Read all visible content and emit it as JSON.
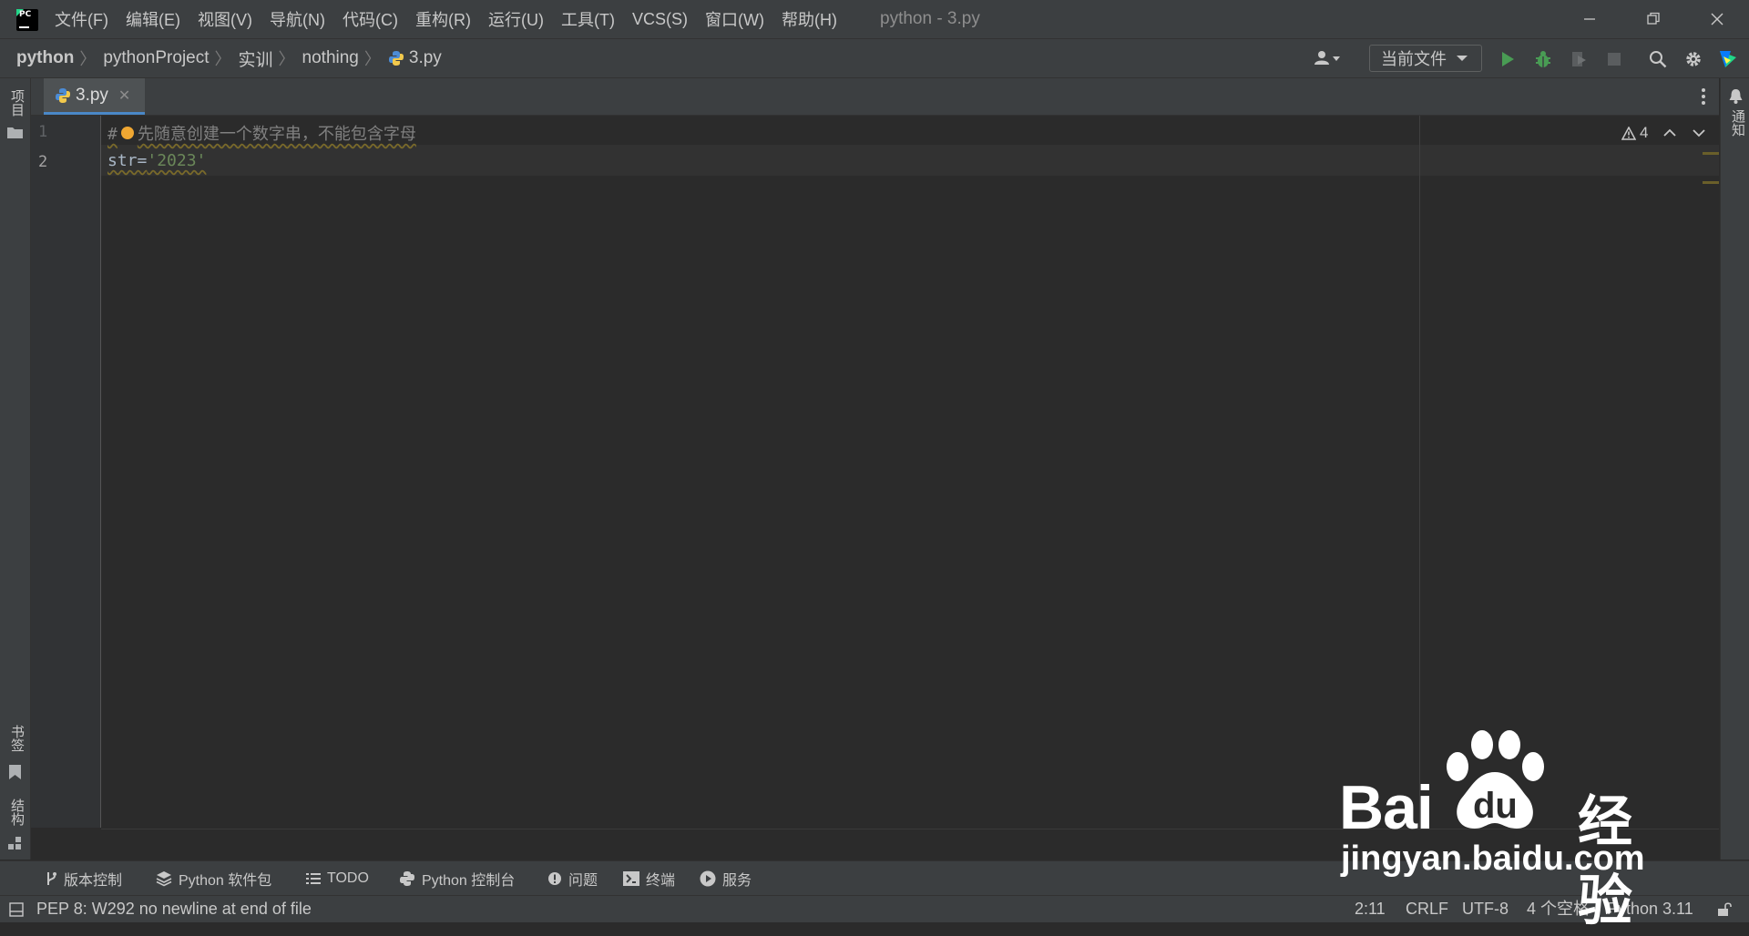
{
  "app": {
    "window_title": "python - 3.py",
    "menu": [
      "文件(F)",
      "编辑(E)",
      "视图(V)",
      "导航(N)",
      "代码(C)",
      "重构(R)",
      "运行(U)",
      "工具(T)",
      "VCS(S)",
      "窗口(W)",
      "帮助(H)"
    ]
  },
  "breadcrumb": {
    "items": [
      "python",
      "pythonProject",
      "实训",
      "nothing",
      "3.py"
    ]
  },
  "toolbar": {
    "run_config": "当前文件"
  },
  "tab": {
    "label": "3.py"
  },
  "left_stripe": {
    "project": "项目",
    "bookmarks": "书签",
    "structure": "结构"
  },
  "right_stripe": {
    "notifications": "通知"
  },
  "editor": {
    "line_numbers": [
      "1",
      "2"
    ],
    "line1_hash": "#",
    "line1_comment": "先随意创建一个数字串，不能包含字母",
    "line2_code": "str=",
    "line2_string": "'2023'",
    "inspection_count": "4"
  },
  "tool_windows": [
    "版本控制",
    "Python 软件包",
    "TODO",
    "Python 控制台",
    "问题",
    "终端",
    "服务"
  ],
  "status": {
    "message": "PEP 8: W292 no newline at end of file",
    "position": "2:11",
    "line_sep": "CRLF",
    "encoding": "UTF-8",
    "indent": "4 个空格",
    "interpreter": "Python 3.11"
  },
  "watermark": {
    "brand": "Bai",
    "brand_suffix": "du",
    "label": "经验",
    "url": "jingyan.baidu.com"
  },
  "colors": {
    "background": "#2b2b2b",
    "panel": "#3c3f41",
    "comment": "#808080",
    "string": "#6a8759",
    "run_green": "#499c54",
    "tab_accent": "#4a88c7"
  }
}
